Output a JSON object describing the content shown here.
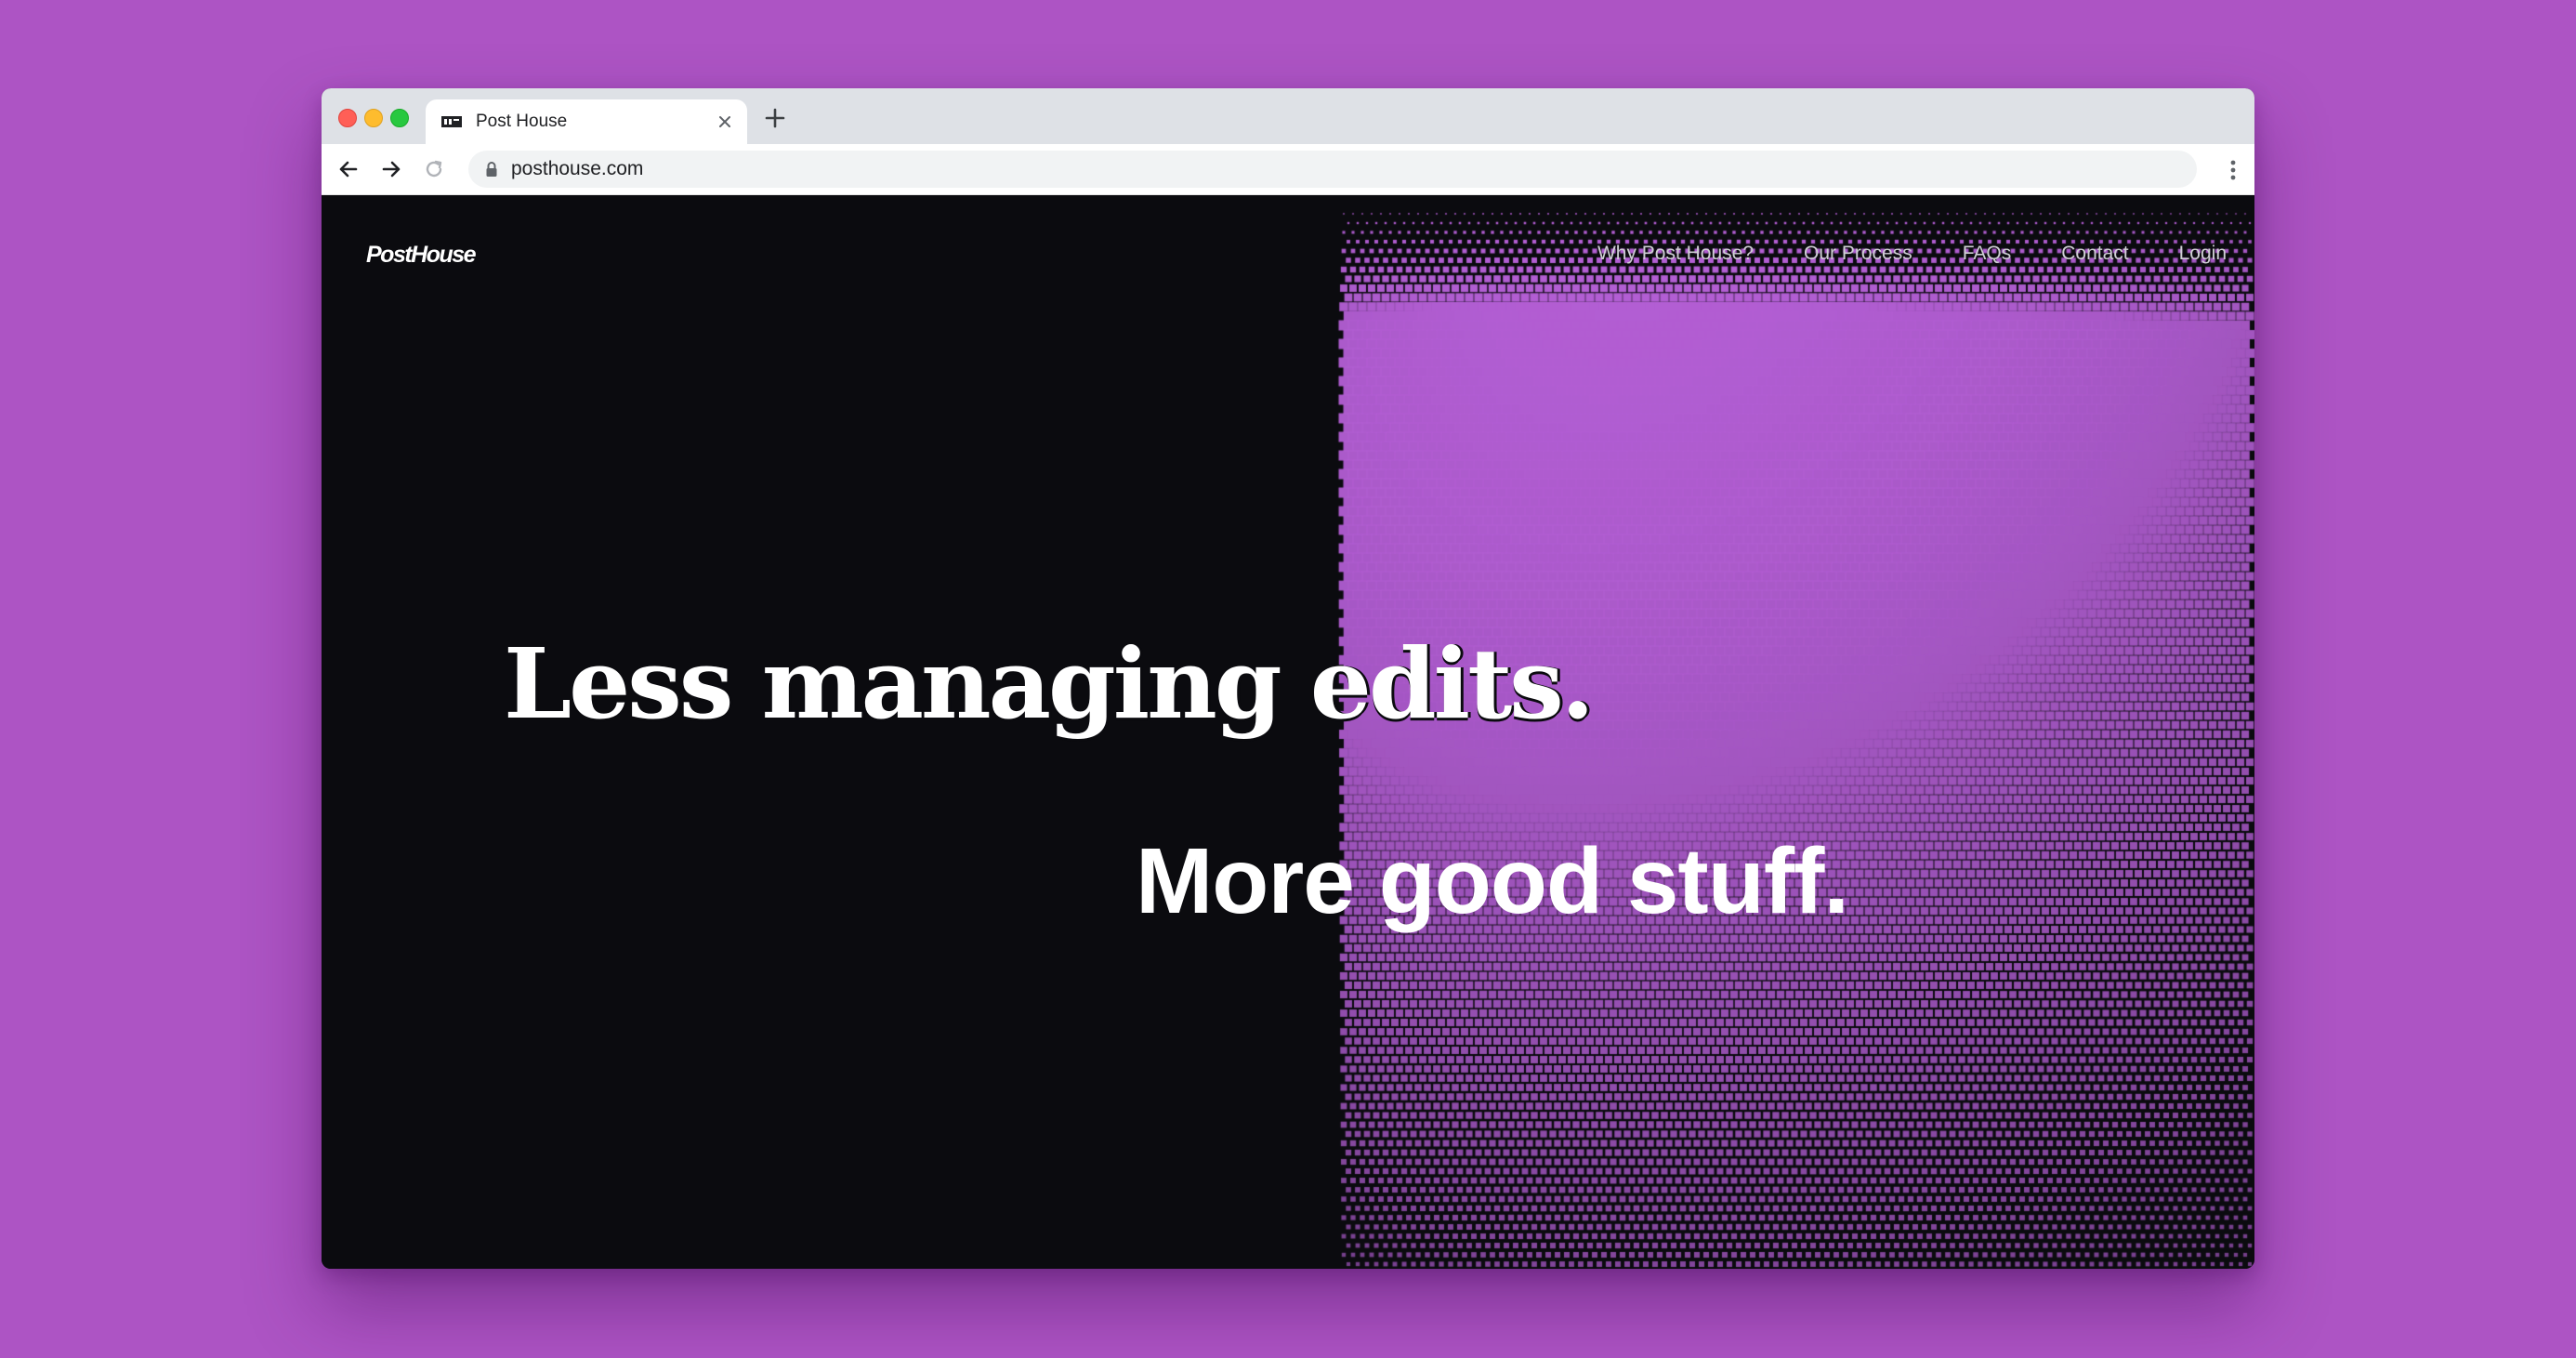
{
  "browser": {
    "tab": {
      "title": "Post House",
      "favicon": "posthouse-favicon-icon"
    },
    "address_bar": {
      "url": "posthouse.com",
      "secure": true
    },
    "icons": {
      "back": "arrow-left-icon",
      "forward": "arrow-right-icon",
      "reload": "reload-icon",
      "close_tab": "close-icon",
      "new_tab": "plus-icon",
      "menu": "more-vertical-icon",
      "lock": "lock-icon"
    }
  },
  "site": {
    "logo": "PostHouse",
    "nav": [
      {
        "label": "Why Post House?"
      },
      {
        "label": "Our Process"
      },
      {
        "label": "FAQs"
      },
      {
        "label": "Contact"
      },
      {
        "label": "Login"
      }
    ],
    "hero": {
      "line1": "Less managing edits.",
      "line2": "More good stuff."
    }
  },
  "colors": {
    "backdrop": "#ad54c4",
    "page_background": "#0b0b0f",
    "sphere_dots": "#b35ed4",
    "text": "#ffffff"
  }
}
